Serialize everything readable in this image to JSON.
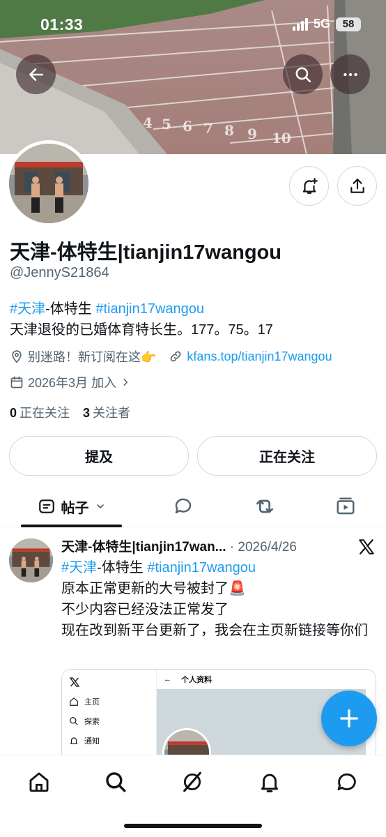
{
  "status_bar": {
    "time": "01:33",
    "network": "5G",
    "battery": "58"
  },
  "profile": {
    "display_name": "天津-体特生|tianjin17wangou",
    "handle": "@JennyS21864",
    "bio_tag1": "#天津",
    "bio_mid": "-体特生 ",
    "bio_tag2": "#tianjin17wangou",
    "bio_line2": "天津退役的已婚体育特长生。177。75。17",
    "location": "别迷路！新订阅在这👉",
    "website": "kfans.top/tianjin17wangou",
    "joined": "2026年3月 加入",
    "following_count": "0",
    "following_label": "正在关注",
    "followers_count": "3",
    "followers_label": "关注者"
  },
  "actions": {
    "mention_label": "提及",
    "following_label": "正在关注"
  },
  "tabs": {
    "posts_label": "帖子"
  },
  "post": {
    "author": "天津-体特生|tianjin17wan...",
    "separator": " · ",
    "date": "2026/4/26",
    "tag1": "#天津",
    "mid": "-体特生 ",
    "tag2": "#tianjin17wangou",
    "line2": "原本正常更新的大号被封了🚨",
    "line3": "不少内容已经没法正常发了",
    "line4": "现在改到新平台更新了，我会在主页新链接等你们",
    "image": {
      "back": "←",
      "title": "个人资料",
      "nav_home": "主页",
      "nav_explore": "探索",
      "nav_notify": "通知"
    }
  },
  "colors": {
    "accent": "#1d9bf0",
    "text": "#0f1419",
    "secondary": "#536471"
  },
  "icons": [
    "back-arrow-icon",
    "search-icon",
    "more-icon",
    "bell-plus-icon",
    "share-icon",
    "location-icon",
    "link-icon",
    "calendar-icon",
    "chevron-right-icon",
    "posts-icon",
    "chevron-down-icon",
    "reply-icon",
    "repost-icon",
    "media-icon",
    "x-logo-icon",
    "compose-icon",
    "home-icon",
    "explore-icon",
    "grok-icon",
    "notifications-icon",
    "messages-icon"
  ]
}
